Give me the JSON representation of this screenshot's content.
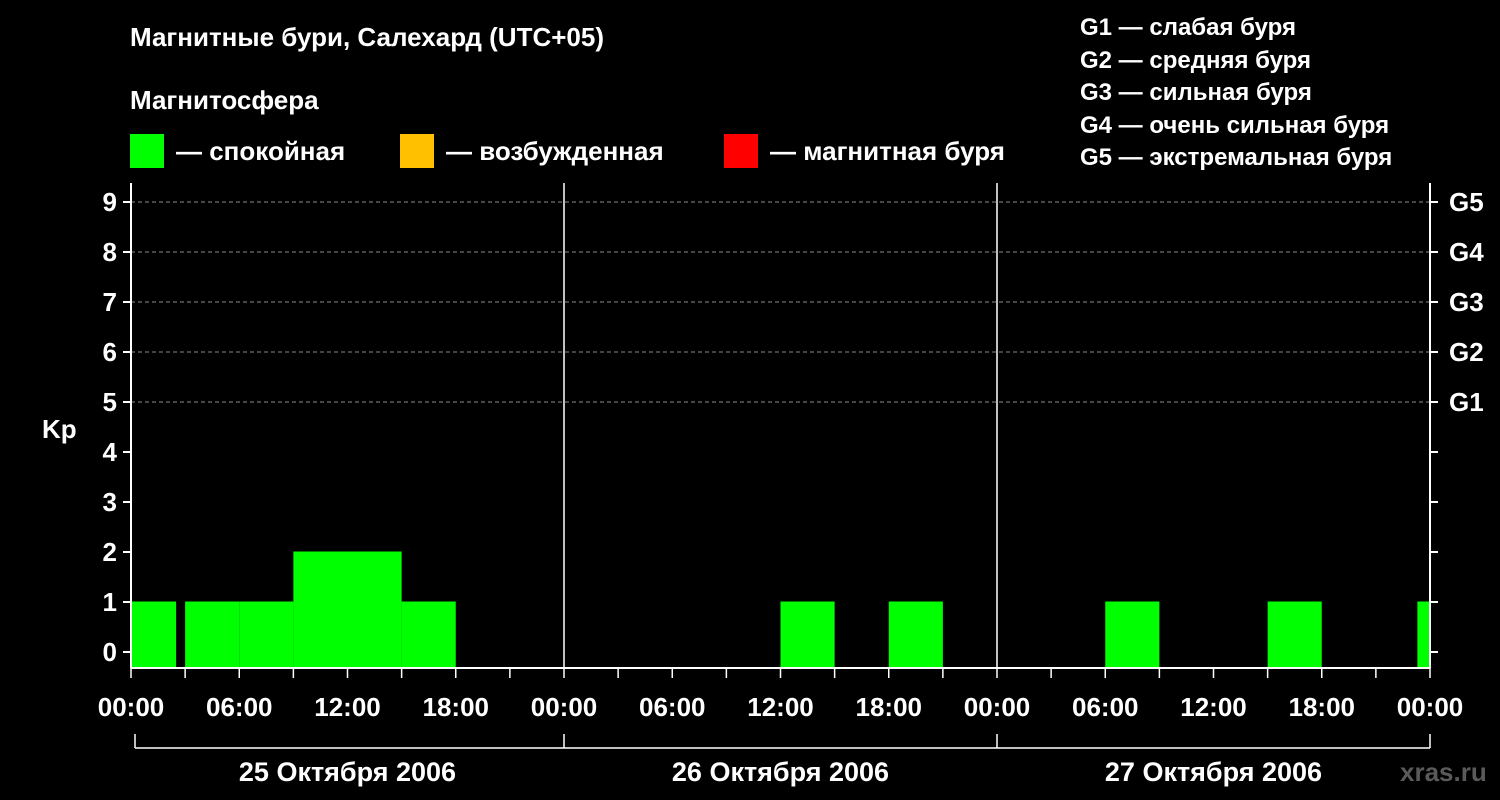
{
  "title": "Магнитные бури, Салехард (UTC+05)",
  "subtitle": "Магнитосфера",
  "states": [
    {
      "label": "— спокойная",
      "color": "#00ff00"
    },
    {
      "label": "— возбужденная",
      "color": "#ffc000"
    },
    {
      "label": "— магнитная буря",
      "color": "#ff0000"
    }
  ],
  "g_legend": [
    "G1 — слабая буря",
    "G2 — средняя буря",
    "G3 — сильная буря",
    "G4 — очень сильная буря",
    "G5 — экстремальная буря"
  ],
  "watermark": "xras.ru",
  "chart_data": {
    "type": "bar",
    "ylabel": "Kp",
    "ylim": [
      0,
      9
    ],
    "y_ticks": [
      "0",
      "1",
      "2",
      "3",
      "4",
      "5",
      "6",
      "7",
      "8",
      "9"
    ],
    "g_scale_ticks": [
      {
        "kp": 5,
        "label": "G1"
      },
      {
        "kp": 6,
        "label": "G2"
      },
      {
        "kp": 7,
        "label": "G3"
      },
      {
        "kp": 8,
        "label": "G4"
      },
      {
        "kp": 9,
        "label": "G5"
      }
    ],
    "x_ticks": [
      "00:00",
      "06:00",
      "12:00",
      "18:00",
      "00:00",
      "06:00",
      "12:00",
      "18:00",
      "00:00",
      "06:00",
      "12:00",
      "18:00",
      "00:00"
    ],
    "days": [
      "25 Октября 2006",
      "26 Октября 2006",
      "27 Октября 2006"
    ],
    "grid": "horizontal dashed at Kp 5–9",
    "bar_color": "#00ff00",
    "bars": [
      {
        "start_hour": 0,
        "end_hour": 2.5,
        "kp": 1
      },
      {
        "start_hour": 3,
        "end_hour": 6,
        "kp": 1
      },
      {
        "start_hour": 6,
        "end_hour": 9,
        "kp": 1
      },
      {
        "start_hour": 9,
        "end_hour": 12,
        "kp": 2
      },
      {
        "start_hour": 12,
        "end_hour": 15,
        "kp": 2
      },
      {
        "start_hour": 15,
        "end_hour": 18,
        "kp": 1
      },
      {
        "start_hour": 36,
        "end_hour": 39,
        "kp": 1
      },
      {
        "start_hour": 42,
        "end_hour": 45,
        "kp": 1
      },
      {
        "start_hour": 54,
        "end_hour": 57,
        "kp": 1
      },
      {
        "start_hour": 63,
        "end_hour": 66,
        "kp": 1
      },
      {
        "start_hour": 71.3,
        "end_hour": 72,
        "kp": 1
      }
    ]
  }
}
